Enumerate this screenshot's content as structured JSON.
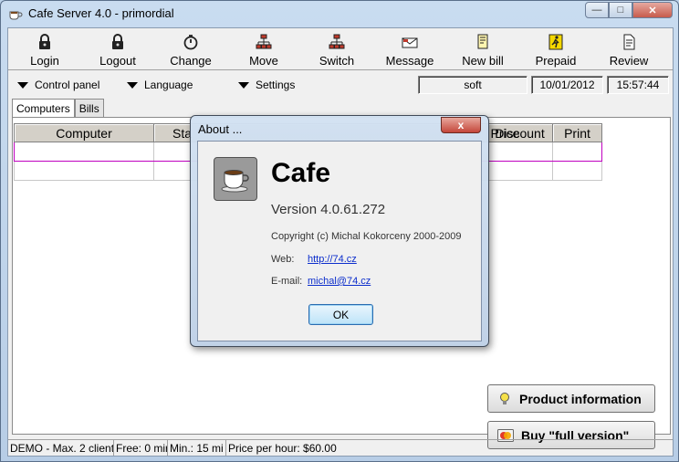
{
  "window": {
    "title": "Cafe Server 4.0 - primordial",
    "min": "—",
    "max": "□",
    "close": "✕"
  },
  "toolbar": [
    {
      "label": "Login",
      "icon": "lock-icon"
    },
    {
      "label": "Logout",
      "icon": "lock-icon"
    },
    {
      "label": "Change",
      "icon": "stopwatch-icon"
    },
    {
      "label": "Move",
      "icon": "network-icon"
    },
    {
      "label": "Switch",
      "icon": "network-icon"
    },
    {
      "label": "Message",
      "icon": "envelope-icon"
    },
    {
      "label": "New bill",
      "icon": "note-icon"
    },
    {
      "label": "Prepaid",
      "icon": "runner-icon"
    },
    {
      "label": "Review",
      "icon": "document-icon"
    }
  ],
  "menu": {
    "control_panel": "Control panel",
    "language": "Language",
    "settings": "Settings",
    "status_user": "soft",
    "date": "10/01/2012",
    "time": "15:57:44"
  },
  "tabs": {
    "computers": "Computers",
    "bills": "Bills"
  },
  "grid": {
    "columns": [
      "Computer",
      "Sta",
      "Price",
      "Discount",
      "Print"
    ]
  },
  "buttons": {
    "product_information": "Product information",
    "buy_full": "Buy \"full version\""
  },
  "statusbar": {
    "demo": "DEMO - Max. 2 client",
    "free": "Free: 0 mir",
    "min": "Min.: 15 mi",
    "price": "Price per hour: $60.00"
  },
  "about": {
    "title": "About ...",
    "close": "x",
    "app_name": "Cafe",
    "version": "Version 4.0.61.272",
    "copyright": "Copyright (c) Michal Kokorceny 2000-2009",
    "web_label": "Web:",
    "web_link": "http://74.cz",
    "email_label": "E-mail:",
    "email_link": "michal@74.cz",
    "ok": "OK"
  }
}
